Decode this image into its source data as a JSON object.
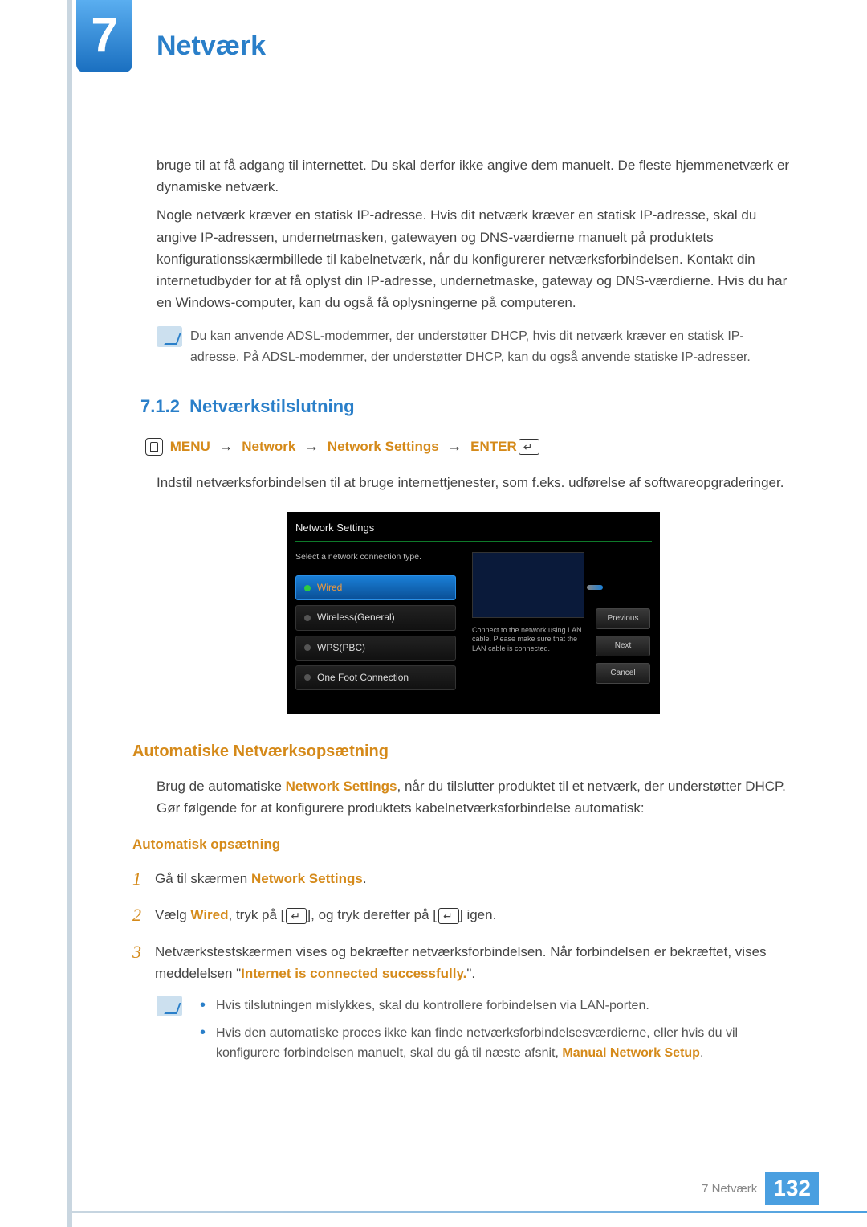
{
  "chapter": {
    "number": "7",
    "title": "Netværk"
  },
  "intro": {
    "p1": "bruge til at få adgang til internettet. Du skal derfor ikke angive dem manuelt. De fleste hjemmenetværk er dynamiske netværk.",
    "p2": "Nogle netværk kræver en statisk IP-adresse. Hvis dit netværk kræver en statisk IP-adresse, skal du angive IP-adressen, undernetmasken, gatewayen og DNS-værdierne manuelt på produktets konfigurationsskærmbillede til kabelnetværk, når du konfigurerer netværksforbindelsen. Kontakt din internetudbyder for at få oplyst din IP-adresse, undernetmaske, gateway og DNS-værdierne. Hvis du har en Windows-computer, kan du også få oplysningerne på computeren.",
    "note": "Du kan anvende ADSL-modemmer, der understøtter DHCP, hvis dit netværk kræver en statisk IP-adresse. På ADSL-modemmer, der understøtter DHCP, kan du også anvende statiske IP-adresser."
  },
  "section": {
    "number": "7.1.2",
    "title": "Netværkstilslutning",
    "path": {
      "menu": "MENU",
      "l1": "Network",
      "l2": "Network Settings",
      "enter": "ENTER"
    },
    "desc": "Indstil netværksforbindelsen til at bruge internettjenester, som f.eks. udførelse af softwareopgraderinger."
  },
  "screenshot": {
    "title": "Network Settings",
    "subtitle": "Select a network connection type.",
    "options": [
      "Wired",
      "Wireless(General)",
      "WPS(PBC)",
      "One Foot Connection"
    ],
    "tip": "Connect to the network using LAN cable. Please make sure that the LAN cable is connected.",
    "buttons": [
      "Previous",
      "Next",
      "Cancel"
    ]
  },
  "auto": {
    "heading": "Automatiske Netværksopsætning",
    "p_a": "Brug de automatiske ",
    "p_kw": "Network Settings",
    "p_b": ", når du tilslutter produktet til et netværk, der understøtter DHCP. Gør følgende for at konfigurere produktets kabelnetværksforbindelse automatisk:",
    "sub": "Automatisk opsætning",
    "steps": {
      "s1_a": "Gå til skærmen ",
      "s1_kw": "Network Settings",
      "s1_b": ".",
      "s2_a": "Vælg ",
      "s2_kw": "Wired",
      "s2_b": ", tryk på [",
      "s2_c": "], og tryk derefter på [",
      "s2_d": "] igen.",
      "s3_a": "Netværkstestskærmen vises og bekræfter netværksforbindelsen. Når forbindelsen er bekræftet, vises meddelelsen \"",
      "s3_kw": "Internet is connected successfully.",
      "s3_b": "\"."
    },
    "note2": {
      "b1": "Hvis tilslutningen mislykkes, skal du kontrollere forbindelsen via LAN-porten.",
      "b2_a": "Hvis den automatiske proces ikke kan finde netværksforbindelsesværdierne, eller hvis du vil konfigurere forbindelsen manuelt, skal du gå til næste afsnit, ",
      "b2_kw": "Manual Network Setup",
      "b2_b": "."
    }
  },
  "footer": {
    "text": "7 Netværk",
    "page": "132"
  }
}
